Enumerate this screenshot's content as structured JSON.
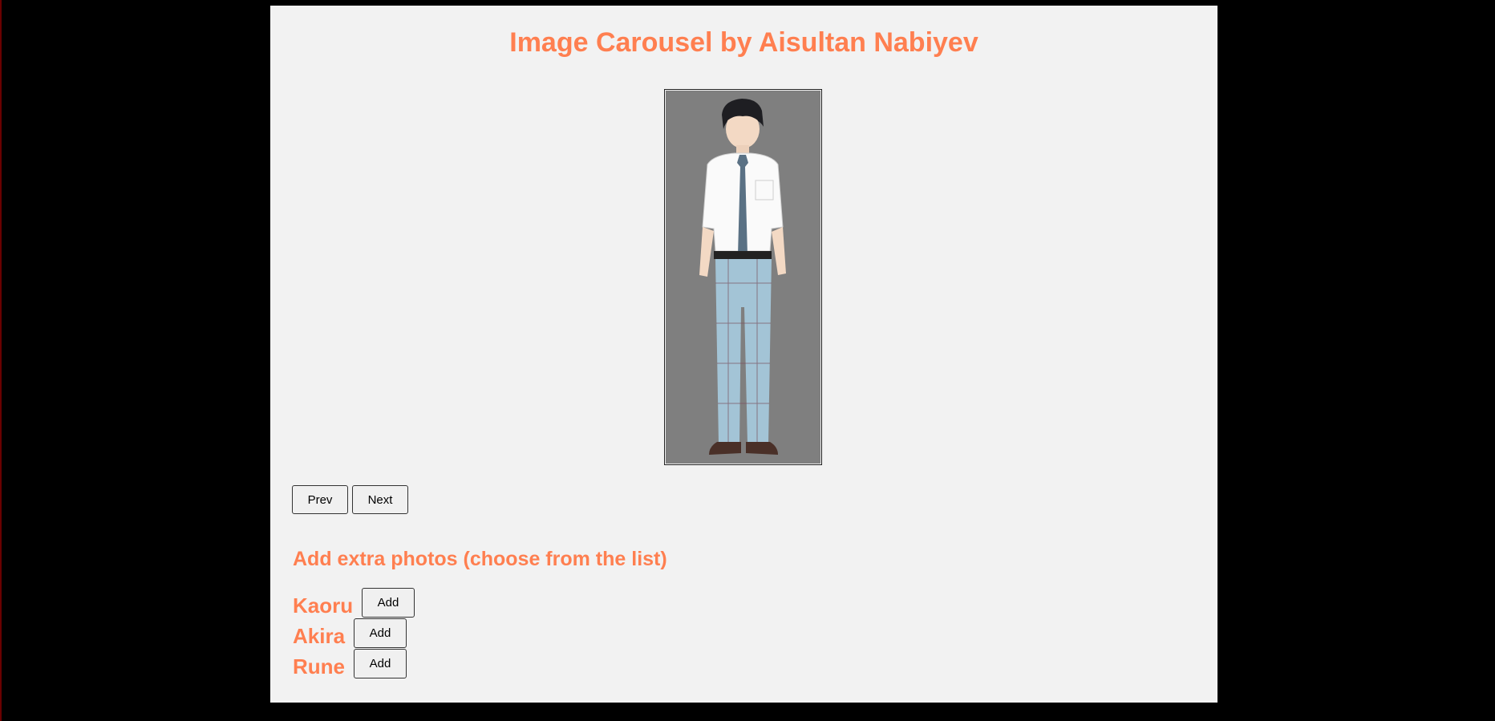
{
  "page": {
    "title": "Image Carousel by Aisultan Nabiyev"
  },
  "carousel": {
    "image_alt": "Character full-body illustration",
    "prev_label": "Prev",
    "next_label": "Next"
  },
  "extras": {
    "heading": "Add extra photos (choose from the list)",
    "items": [
      {
        "name": "Kaoru",
        "button_label": "Add"
      },
      {
        "name": "Akira",
        "button_label": "Add"
      },
      {
        "name": "Rune",
        "button_label": "Add"
      }
    ]
  },
  "colors": {
    "accent": "#ff7f50",
    "panel": "#f2f2f2",
    "background": "#000000",
    "image_bg": "#7f7f7f"
  }
}
